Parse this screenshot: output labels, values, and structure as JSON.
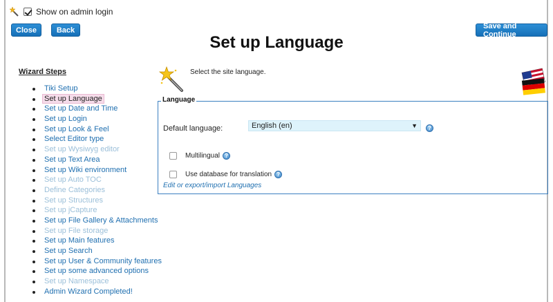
{
  "topbar": {
    "show_on_admin_login": "Show on admin login",
    "checked": true
  },
  "buttons": {
    "close": "Close",
    "back": "Back",
    "save_continue": "Save and Continue"
  },
  "title": "Set up Language",
  "wizard": {
    "title": "Wizard Steps",
    "steps": [
      {
        "label": "Tiki Setup",
        "state": "enabled"
      },
      {
        "label": "Set up Language",
        "state": "active"
      },
      {
        "label": "Set up Date and Time",
        "state": "enabled"
      },
      {
        "label": "Set up Login",
        "state": "enabled"
      },
      {
        "label": "Set up Look & Feel",
        "state": "enabled"
      },
      {
        "label": "Select Editor type",
        "state": "enabled"
      },
      {
        "label": "Set up Wysiwyg editor",
        "state": "disabled"
      },
      {
        "label": "Set up Text Area",
        "state": "enabled"
      },
      {
        "label": "Set up Wiki environment",
        "state": "enabled"
      },
      {
        "label": "Set up Auto TOC",
        "state": "disabled"
      },
      {
        "label": "Define Categories",
        "state": "disabled"
      },
      {
        "label": "Set up Structures",
        "state": "disabled"
      },
      {
        "label": "Set up jCapture",
        "state": "disabled"
      },
      {
        "label": "Set up File Gallery & Attachments",
        "state": "enabled"
      },
      {
        "label": "Set up File storage",
        "state": "disabled"
      },
      {
        "label": "Set up Main features",
        "state": "enabled"
      },
      {
        "label": "Set up Search",
        "state": "enabled"
      },
      {
        "label": "Set up User & Community features",
        "state": "enabled"
      },
      {
        "label": "Set up some advanced options",
        "state": "enabled"
      },
      {
        "label": "Set up Namespace",
        "state": "disabled"
      },
      {
        "label": "Admin Wizard Completed!",
        "state": "enabled"
      }
    ]
  },
  "content": {
    "intro": "Select the site language.",
    "fieldset_legend": "Language",
    "default_language_label": "Default language:",
    "default_language_value": "English (en)",
    "multilingual_label": "Multilingual",
    "db_translation_label": "Use database for translation",
    "edit_link": "Edit or export/import Languages"
  },
  "colors": {
    "button": "#1f7cc6",
    "link": "#1f6fb0",
    "disabled_link": "#9bbfd9",
    "active_bg": "#f6dcea",
    "fieldset_border": "#3a7fc0"
  },
  "icons": {
    "wand": "magic-wand-icon",
    "flag": "language-flags-icon",
    "help": "help-icon"
  }
}
